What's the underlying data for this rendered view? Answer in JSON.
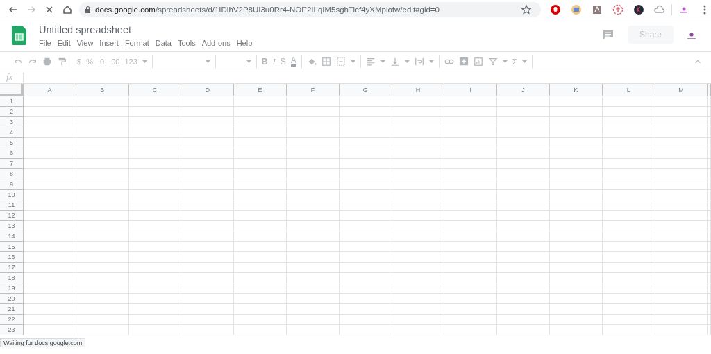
{
  "browser": {
    "url_host": "docs.google.com",
    "url_path": "/spreadsheets/d/1IDlhV2P8UI3u0Rr4-NOE2ILqIM5sghTicf4yXMpiofw/edit#gid=0"
  },
  "document": {
    "title": "Untitled spreadsheet",
    "menu": [
      "File",
      "Edit",
      "View",
      "Insert",
      "Format",
      "Data",
      "Tools",
      "Add-ons",
      "Help"
    ],
    "share_button": "Share"
  },
  "toolbar": {
    "format_buttons": [
      "$",
      "%",
      ".0",
      ".00",
      "123"
    ],
    "text_buttons": [
      "B",
      "I",
      "S",
      "A"
    ],
    "sum_button": "Σ"
  },
  "formula_bar": {
    "label": "fx"
  },
  "grid": {
    "columns": [
      "A",
      "B",
      "C",
      "D",
      "E",
      "F",
      "G",
      "H",
      "I",
      "J",
      "K",
      "L",
      "M"
    ],
    "rows": [
      "1",
      "2",
      "3",
      "4",
      "5",
      "6",
      "7",
      "8",
      "9",
      "10",
      "11",
      "12",
      "13",
      "14",
      "15",
      "16",
      "17",
      "18",
      "19",
      "20",
      "21",
      "22",
      "23"
    ]
  },
  "status_bar": "Waiting for docs.google.com"
}
